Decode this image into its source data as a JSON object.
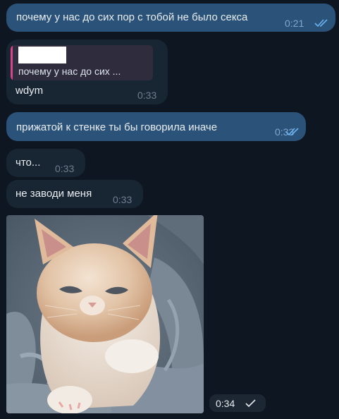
{
  "messages": [
    {
      "direction": "out",
      "text": "почему у нас до сих пор с тобой не было секса",
      "time": "0:21",
      "status": "read"
    },
    {
      "direction": "in",
      "reply_quote": "почему у нас до сих ...",
      "text": "wdym",
      "time": "0:33"
    },
    {
      "direction": "out",
      "text": "прижатой к стенке ты бы говорила иначе",
      "time": "0:33",
      "status": "read"
    },
    {
      "direction": "in",
      "text": "что...",
      "time": "0:33"
    },
    {
      "direction": "in",
      "text": "не заводи меня",
      "time": "0:33"
    },
    {
      "direction": "in",
      "media": "kitten-video",
      "time": "0:34",
      "status": "sent"
    }
  ],
  "colors": {
    "background": "#0e1621",
    "outgoing_bubble": "#2b5278",
    "incoming_bubble": "#182533",
    "reply_accent": "#d8458c",
    "read_check": "#6ab3f3"
  }
}
